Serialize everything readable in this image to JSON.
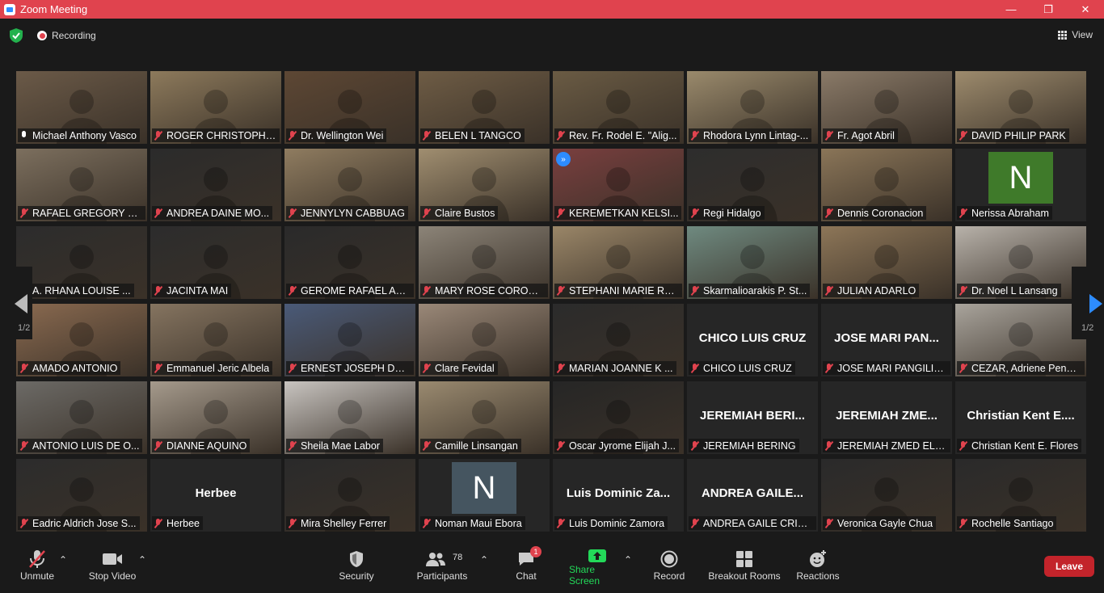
{
  "window": {
    "title": "Zoom Meeting",
    "controls": {
      "minimize": "—",
      "restore": "❐",
      "close": "✕"
    }
  },
  "topbar": {
    "recording_label": "Recording",
    "view_label": "View"
  },
  "pager": {
    "left_page": "1/2",
    "right_page": "1/2"
  },
  "participants": [
    {
      "name": "Michael Anthony Vasco",
      "muted": false,
      "active": true,
      "video": "#6b5a48"
    },
    {
      "name": "ROGER CHRISTOPHE...",
      "muted": true,
      "video": "#8d7a5c"
    },
    {
      "name": "Dr. Wellington Wei",
      "muted": true,
      "video": "#5d4734"
    },
    {
      "name": "BELEN L TANGCO",
      "muted": true,
      "video": "#6e5c45"
    },
    {
      "name": "Rev. Fr. Rodel E. \"Alig...",
      "muted": true,
      "video": "#6a5b44"
    },
    {
      "name": "Rhodora Lynn Lintag-...",
      "muted": true,
      "video": "#9a8a6c"
    },
    {
      "name": "Fr. Agot Abril",
      "muted": true,
      "video": "#8a7a68"
    },
    {
      "name": "DAVID PHILIP PARK",
      "muted": true,
      "video": "#9d8b6d"
    },
    {
      "name": "RAFAEL GREGORY LA...",
      "muted": true,
      "video": "#7c6f5e"
    },
    {
      "name": "ANDREA DAINE MO...",
      "muted": true,
      "video": "#2b2b2b"
    },
    {
      "name": "JENNYLYN CABBUAG",
      "muted": true,
      "video": "#8f7c60"
    },
    {
      "name": "Claire Bustos",
      "muted": true,
      "video": "#a08e70"
    },
    {
      "name": "KEREMETKAN KELSI...",
      "muted": true,
      "video": "#7a3f3f",
      "forward": "»"
    },
    {
      "name": "Regi Hidalgo",
      "muted": true,
      "video": "#2d2d2d"
    },
    {
      "name": "Dennis Coronacion",
      "muted": true,
      "video": "#8a7558"
    },
    {
      "name": "Nerissa Abraham",
      "muted": true,
      "avatar": "N",
      "avatar_color": "#3f7a2a"
    },
    {
      "name": "A. RHANA LOUISE ...",
      "muted": true,
      "video": "#2c2c2c"
    },
    {
      "name": "JACINTA MAI",
      "muted": true,
      "video": "#2c2c2c"
    },
    {
      "name": "GEROME RAFAEL AU...",
      "muted": true,
      "video": "#2a2a2a"
    },
    {
      "name": "MARY ROSE CORONEL",
      "muted": true,
      "video": "#8c8478"
    },
    {
      "name": "STEPHANI MARIE RA...",
      "muted": true,
      "video": "#9a8668"
    },
    {
      "name": "Skarmalioarakis P. St...",
      "muted": true,
      "video": "#6f8a80"
    },
    {
      "name": "JULIAN ADARLO",
      "muted": true,
      "video": "#8d7658"
    },
    {
      "name": "Dr. Noel L Lansang",
      "muted": true,
      "video": "#b8b2aa"
    },
    {
      "name": "AMADO ANTONIO",
      "muted": true,
      "video": "#8a6a50"
    },
    {
      "name": "Emmanuel Jeric Albela",
      "muted": true,
      "video": "#857460"
    },
    {
      "name": "ERNEST JOSEPH DO...",
      "muted": true,
      "video": "#4a5a78"
    },
    {
      "name": "Clare Fevidal",
      "muted": true,
      "video": "#9a8878"
    },
    {
      "name": "MARIAN JOANNE K ...",
      "muted": true,
      "video": "#2b2b2b"
    },
    {
      "name": "CHICO LUIS CRUZ",
      "muted": true,
      "bigname": "CHICO LUIS CRUZ"
    },
    {
      "name": "JOSE MARI PANGILIN...",
      "muted": true,
      "bigname": "JOSE MARI PAN..."
    },
    {
      "name": "CEZAR, Adriene Penn ...",
      "muted": true,
      "video": "#a9a49c"
    },
    {
      "name": "ANTONIO LUIS DE O...",
      "muted": true,
      "video": "#6c6a66"
    },
    {
      "name": "DIANNE AQUINO",
      "muted": true,
      "video": "#a59a8c"
    },
    {
      "name": "Sheila Mae Labor",
      "muted": true,
      "video": "#c8c4c0"
    },
    {
      "name": "Camille Linsangan",
      "muted": true,
      "video": "#9a8a70"
    },
    {
      "name": "Oscar Jyrome Elijah J...",
      "muted": true,
      "video": "#262626"
    },
    {
      "name": "JEREMIAH BERING",
      "muted": true,
      "bigname": "JEREMIAH BERI..."
    },
    {
      "name": "JEREMIAH ZMED ELE...",
      "muted": true,
      "bigname": "JEREMIAH ZME..."
    },
    {
      "name": "Christian Kent E. Flores",
      "muted": true,
      "bigname": "Christian Kent E...."
    },
    {
      "name": "Eadric Aldrich Jose S...",
      "muted": true,
      "video": "#2c2c2c"
    },
    {
      "name": "Herbee",
      "muted": true,
      "bigname": "Herbee"
    },
    {
      "name": "Mira Shelley Ferrer",
      "muted": true,
      "video": "#2a2a2a"
    },
    {
      "name": "Noman Maui Ebora",
      "muted": true,
      "avatar": "N",
      "avatar_color": "#455560"
    },
    {
      "name": "Luis Dominic Zamora",
      "muted": true,
      "bigname": "Luis Dominic Za..."
    },
    {
      "name": "ANDREA GAILE CRIST...",
      "muted": true,
      "bigname": "ANDREA GAILE..."
    },
    {
      "name": "Veronica Gayle Chua",
      "muted": true,
      "video": "#2a2a2a"
    },
    {
      "name": "Rochelle Santiago",
      "muted": true,
      "video": "#2a2a2a"
    }
  ],
  "toolbar": {
    "unmute": "Unmute",
    "stop_video": "Stop Video",
    "security": "Security",
    "participants": "Participants",
    "participants_count": "78",
    "chat": "Chat",
    "chat_badge": "1",
    "share_screen": "Share Screen",
    "record": "Record",
    "breakout_rooms": "Breakout Rooms",
    "reactions": "Reactions",
    "leave": "Leave"
  },
  "colors": {
    "titlebar": "#e0434e",
    "active_speaker": "#c7e23a",
    "share_green": "#23d959",
    "leave_red": "#c3242b",
    "next_arrow": "#2d8cff"
  }
}
